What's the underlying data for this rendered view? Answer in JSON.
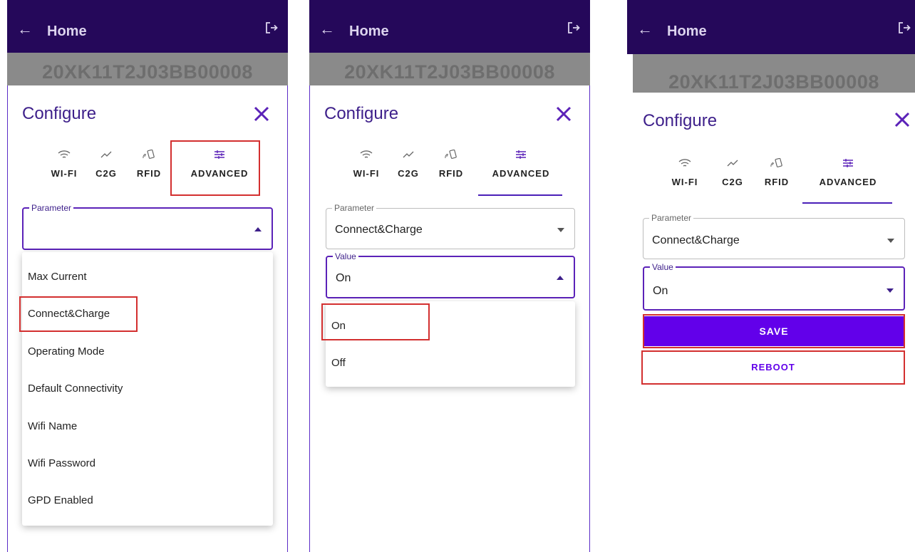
{
  "appbar": {
    "title": "Home"
  },
  "serial": "20XK11T2J03BB00008",
  "dialog": {
    "title": "Configure"
  },
  "tabs": [
    "WI-FI",
    "C2G",
    "RFID",
    "ADVANCED"
  ],
  "icons": {
    "wifi": "wifi-icon",
    "c2g": "trend-icon",
    "rfid": "rfid-icon",
    "advanced": "tune-icon",
    "close": "close-icon",
    "back": "back-arrow-icon",
    "logout": "logout-icon"
  },
  "colors": {
    "appbar": "#25085a",
    "accent": "#6200ea",
    "highlight": "#d32f2f"
  },
  "screen1": {
    "parameter_label": "Parameter",
    "parameter_value": "",
    "options": [
      "Max Current",
      "Connect&Charge",
      "Operating Mode",
      "Default Connectivity",
      "Wifi Name",
      "Wifi Password",
      "GPD Enabled"
    ]
  },
  "screen2": {
    "parameter_label": "Parameter",
    "parameter_value": "Connect&Charge",
    "value_label": "Value",
    "value_value": "On",
    "options": [
      "On",
      "Off"
    ]
  },
  "screen3": {
    "parameter_label": "Parameter",
    "parameter_value": "Connect&Charge",
    "value_label": "Value",
    "value_value": "On",
    "save_label": "SAVE",
    "reboot_label": "REBOOT"
  }
}
